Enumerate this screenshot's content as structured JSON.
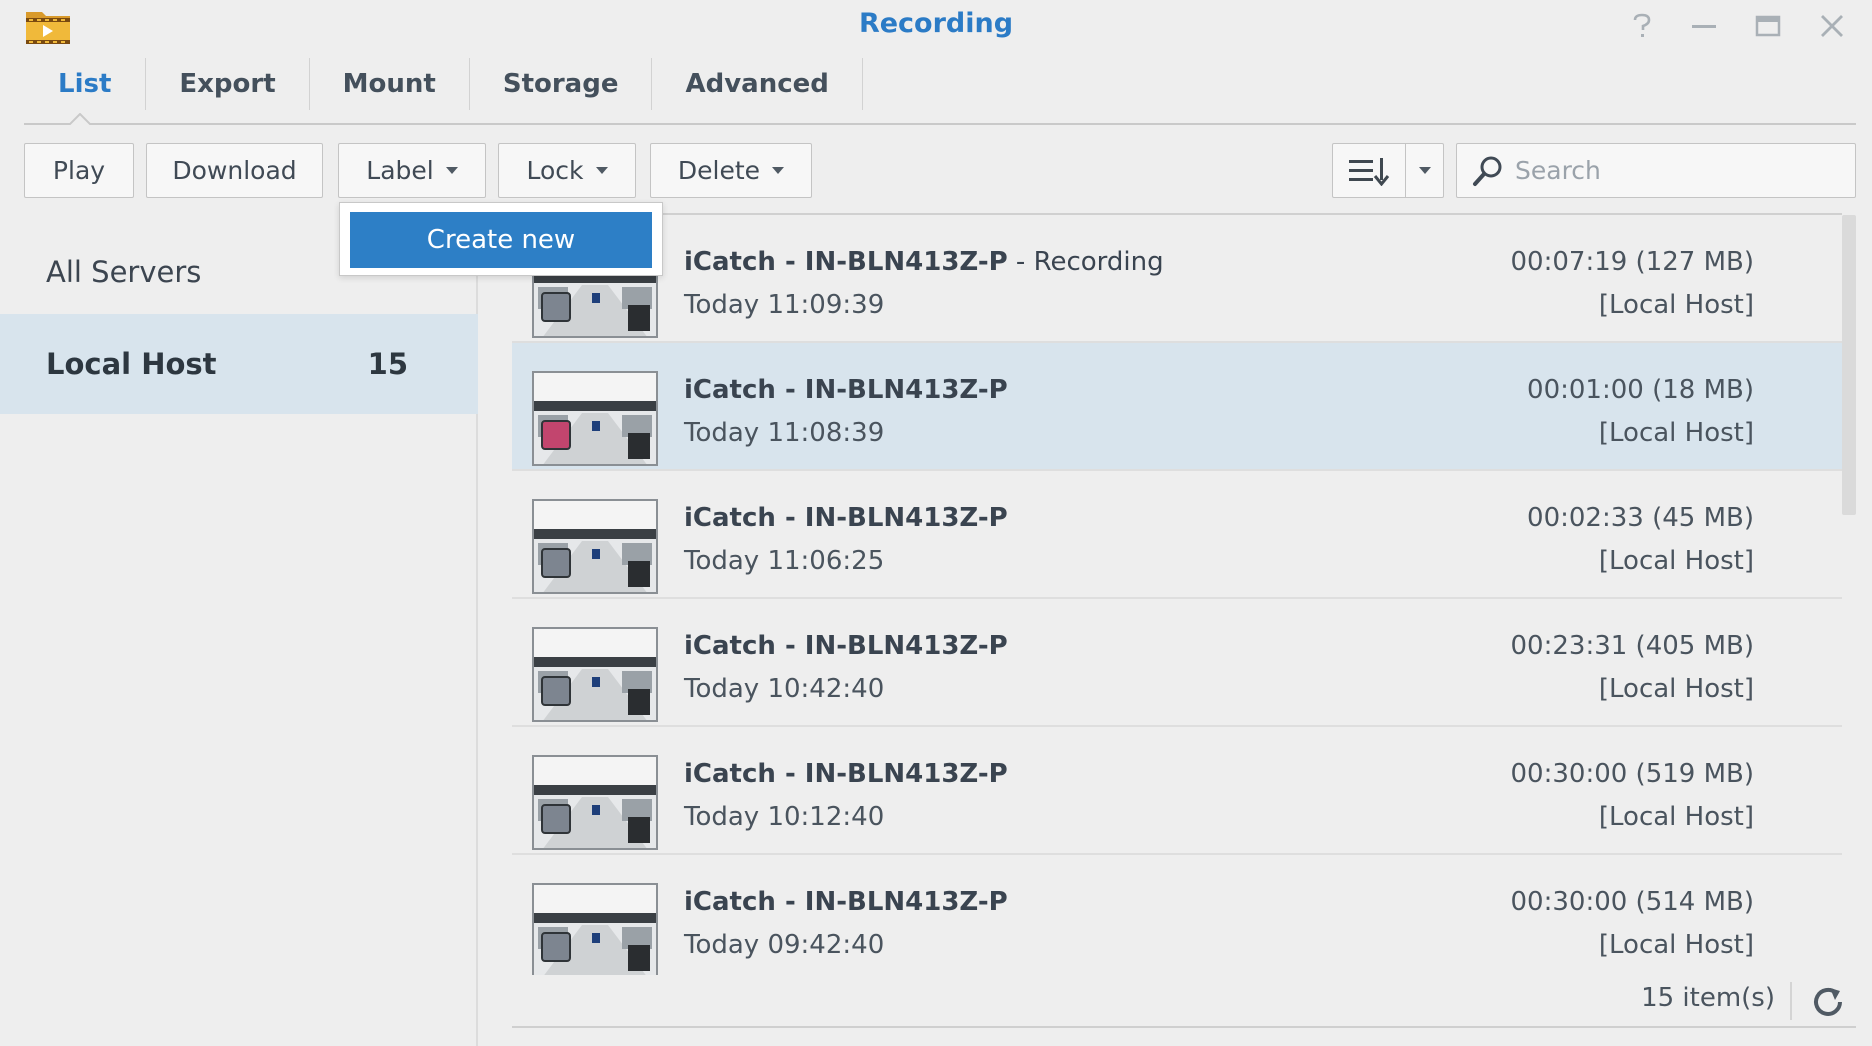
{
  "window": {
    "title": "Recording",
    "icon": "video-folder-icon"
  },
  "tabs": [
    {
      "label": "List",
      "active": true
    },
    {
      "label": "Export",
      "active": false
    },
    {
      "label": "Mount",
      "active": false
    },
    {
      "label": "Storage",
      "active": false
    },
    {
      "label": "Advanced",
      "active": false
    }
  ],
  "toolbar": {
    "play_label": "Play",
    "download_label": "Download",
    "label_label": "Label",
    "lock_label": "Lock",
    "delete_label": "Delete",
    "search_placeholder": "Search"
  },
  "label_menu": {
    "items": [
      "Create new"
    ]
  },
  "sidebar": {
    "items": [
      {
        "label": "All Servers",
        "count": ""
      },
      {
        "label": "Local Host",
        "count": "15",
        "selected": true
      }
    ]
  },
  "recordings": [
    {
      "camera": "iCatch - IN-BLN413Z-P",
      "suffix": " - Recording",
      "time": "Today 11:09:39",
      "duration": "00:07:19 (127 MB)",
      "host": "[Local Host]",
      "label_color": "#7d8590",
      "selected": false
    },
    {
      "camera": "iCatch - IN-BLN413Z-P",
      "suffix": "",
      "time": "Today 11:08:39",
      "duration": "00:01:00 (18 MB)",
      "host": "[Local Host]",
      "label_color": "#c2456e",
      "selected": true
    },
    {
      "camera": "iCatch - IN-BLN413Z-P",
      "suffix": "",
      "time": "Today 11:06:25",
      "duration": "00:02:33 (45 MB)",
      "host": "[Local Host]",
      "label_color": "#7d8590",
      "selected": false
    },
    {
      "camera": "iCatch - IN-BLN413Z-P",
      "suffix": "",
      "time": "Today 10:42:40",
      "duration": "00:23:31 (405 MB)",
      "host": "[Local Host]",
      "label_color": "#7d8590",
      "selected": false
    },
    {
      "camera": "iCatch - IN-BLN413Z-P",
      "suffix": "",
      "time": "Today 10:12:40",
      "duration": "00:30:00 (519 MB)",
      "host": "[Local Host]",
      "label_color": "#7d8590",
      "selected": false
    },
    {
      "camera": "iCatch - IN-BLN413Z-P",
      "suffix": "",
      "time": "Today 09:42:40",
      "duration": "00:30:00 (514 MB)",
      "host": "[Local Host]",
      "label_color": "#7d8590",
      "selected": false
    }
  ],
  "footer": {
    "item_count": "15 item(s)"
  },
  "colors": {
    "accent": "#2b7bc6",
    "selected_row": "#d8e4ed",
    "menu_highlight": "#2d7fc6"
  }
}
